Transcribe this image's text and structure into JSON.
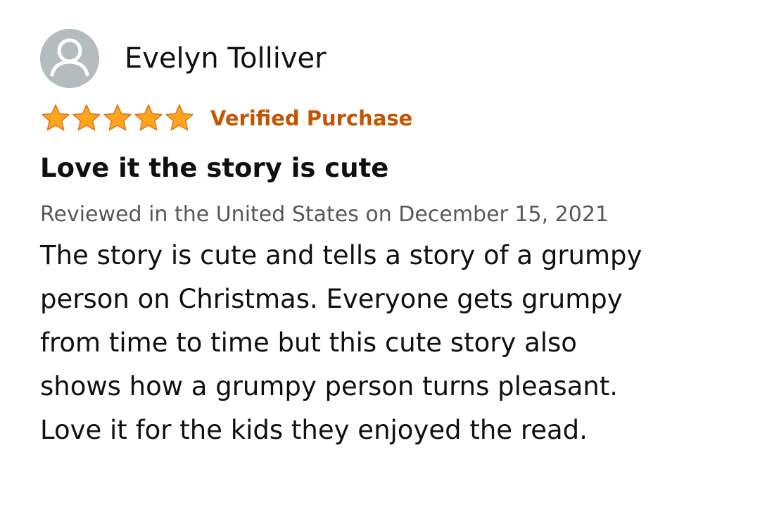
{
  "review": {
    "reviewer_name": "Evelyn Tolliver",
    "avatar_icon": "user-silhouette-icon",
    "rating": 5,
    "rating_max": 5,
    "star_icon": "star-icon",
    "star_color": "#ffa41c",
    "verified_label": "Verified Purchase",
    "verified_color": "#c45500",
    "title": "Love it the story is cute",
    "date_text": "Reviewed in the United States on December 15, 2021",
    "body_lines": [
      "The story is cute and tells a story of a grumpy",
      "person on Christmas. Everyone gets grumpy",
      "from time to time but this cute story also",
      "shows how a grumpy person turns pleasant.",
      "Love it for the kids they enjoyed the read."
    ]
  }
}
